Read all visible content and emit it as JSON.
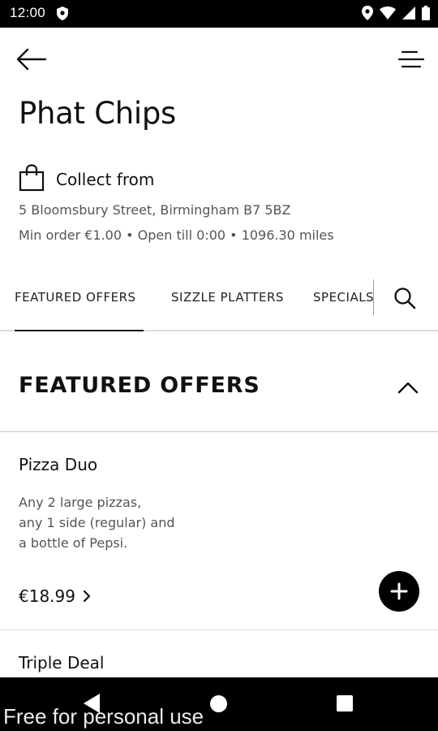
{
  "status_bar": {
    "time": "12:00",
    "icons": [
      "shield-icon",
      "location-icon",
      "wifi-icon",
      "signal-icon",
      "battery-icon"
    ]
  },
  "toolbar": {
    "back_icon": "arrow-left-icon",
    "menu_icon": "menu-icon"
  },
  "store": {
    "name": "Phat Chips",
    "mode_label": "Collect from",
    "mode_icon": "shopping-bag-icon",
    "address": "5 Bloomsbury Street, Birmingham B7 5BZ",
    "meta": "Min order €1.00 • Open till 0:00 • 1096.30  miles"
  },
  "tabs": [
    {
      "label": "FEATURED OFFERS",
      "active": true
    },
    {
      "label": "SIZZLE PLATTERS",
      "active": false
    },
    {
      "label": "SPECIALS",
      "active": false
    }
  ],
  "section": {
    "title": "FEATURED OFFERS",
    "collapse_icon": "chevron-up-icon"
  },
  "items": [
    {
      "name": "Pizza Duo",
      "description_lines": [
        "Any 2 large pizzas,",
        "any 1 side (regular) and",
        "a bottle of Pepsi."
      ],
      "price": "€18.99"
    },
    {
      "name": "Triple Deal"
    }
  ],
  "nav_bar": {
    "watermark": "Free for personal use"
  },
  "colors": {
    "primary": "#000000",
    "text_muted": "#555555",
    "divider": "#dddddd"
  }
}
